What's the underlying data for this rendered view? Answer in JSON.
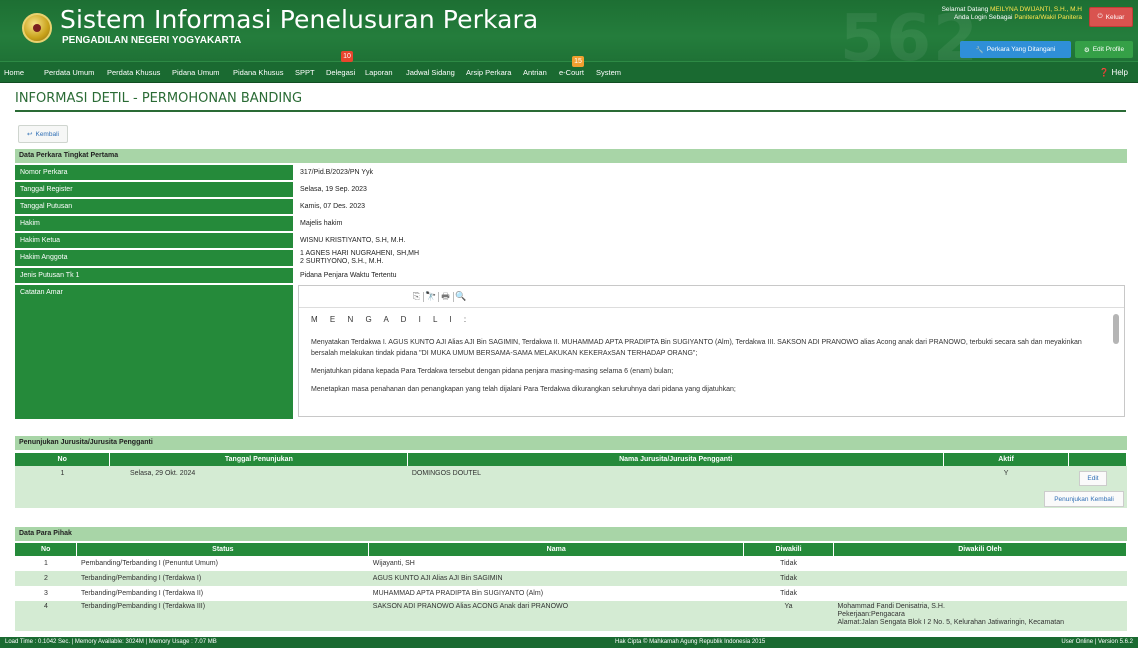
{
  "header": {
    "watermark": "562",
    "title": "Sistem Informasi Penelusuran Perkara",
    "subtitle": "PENGADILAN NEGERI YOGYAKARTA",
    "welcome_prefix": "Selamat Datang",
    "user_name": "MEILYNA DWIJANTI, S.H., M.H",
    "login_prefix": "Anda Login Sebagai",
    "role": "Panitera/Wakil Panitera",
    "logout_label": "Keluar",
    "perkara_ditangani_label": "Perkara Yang Ditangani",
    "edit_profile_label": "Edit Profile"
  },
  "nav": {
    "items": [
      "Home",
      "Perdata Umum",
      "Perdata Khusus",
      "Pidana Umum",
      "Pidana Khusus",
      "SPPT",
      "Delegasi",
      "Laporan",
      "Jadwal Sidang",
      "Arsip Perkara",
      "Antrian",
      "e-Court",
      "System"
    ],
    "delegasi_badge": "10",
    "ecourt_badge": "15",
    "help_label": "Help"
  },
  "page": {
    "title": "INFORMASI DETIL - PERMOHONAN BANDING",
    "back_label": "Kembali"
  },
  "perkara": {
    "section_title": "Data Perkara Tingkat Pertama",
    "rows": [
      {
        "label": "Nomor Perkara",
        "value": "317/Pid.B/2023/PN Yyk"
      },
      {
        "label": "Tanggal Register",
        "value": "Selasa, 19 Sep. 2023"
      },
      {
        "label": "Tanggal Putusan",
        "value": "Kamis, 07 Des. 2023"
      },
      {
        "label": "Hakim",
        "value": "Majelis hakim"
      },
      {
        "label": "Hakim Ketua",
        "value": "WISNU KRISTIYANTO, S.H, M.H."
      },
      {
        "label": "Hakim Anggota",
        "value": "1 AGNES HARI NUGRAHENI, SH,MH",
        "value2": "2 SURTIYONO, S.H., M.H."
      },
      {
        "label": "Jenis Putusan Tk 1",
        "value": "Pidana Penjara Waktu Tertentu"
      },
      {
        "label": "Catatan Amar"
      }
    ],
    "amar": {
      "heading": "M E N G A D I L I :",
      "p1": "Menyatakan Terdakwa I. AGUS KUNTO AJI Alias AJI Bin SAGIMIN, Terdakwa II. MUHAMMAD APTA PRADIPTA Bin SUGIYANTO (Alm), Terdakwa III. SAKSON ADI PRANOWO alias Acong anak dari PRANOWO, terbukti secara sah dan meyakinkan bersalah melakukan tindak pidana \"DI MUKA UMUM  BERSAMA-SAMA MELAKUKAN KEKERAxSAN TERHADAP ORANG\";",
      "p2": "Menjatuhkan pidana kepada Para Terdakwa tersebut dengan pidana penjara masing-masing selama 6 (enam) bulan;",
      "p3": "Menetapkan masa penahanan dan penangkapan yang telah dijalani Para Terdakwa dikurangkan seluruhnya dari pidana yang dijatuhkan;"
    }
  },
  "jurusita": {
    "section_title": "Penunjukan Jurusita/Jurusita Pengganti",
    "columns": [
      "No",
      "Tanggal Penunjukan",
      "Nama Jurusita/Jurusita Pengganti",
      "Aktif"
    ],
    "rows": [
      {
        "no": "1",
        "tanggal": "Selasa, 29 Okt. 2024",
        "nama": "DOMINGOS DOUTEL",
        "aktif": "Y"
      }
    ],
    "edit_label": "Edit",
    "penunjukan_kembali_label": "Penunjukan Kembali"
  },
  "pihak": {
    "section_title": "Data Para Pihak",
    "columns": [
      "No",
      "Status",
      "Nama",
      "Diwakili",
      "Diwakili Oleh"
    ],
    "rows": [
      {
        "no": "1",
        "status": "Pembanding/Terbanding I (Penuntut Umum)",
        "nama": "Wijayanti, SH",
        "diwakili": "Tidak",
        "oleh": ""
      },
      {
        "no": "2",
        "status": "Terbanding/Pembanding I (Terdakwa I)",
        "nama": "AGUS KUNTO AJI Alias AJI Bin SAGIMIN",
        "diwakili": "Tidak",
        "oleh": ""
      },
      {
        "no": "3",
        "status": "Terbanding/Pembanding I (Terdakwa II)",
        "nama": "MUHAMMAD APTA PRADIPTA Bin SUGIYANTO (Alm)",
        "diwakili": "Tidak",
        "oleh": ""
      },
      {
        "no": "4",
        "status": "Terbanding/Pembanding I (Terdakwa III)",
        "nama": "SAKSON ADI PRANOWO Alias ACONG Anak dari PRANOWO",
        "diwakili": "Ya",
        "oleh": "Mohammad Fandi Denisatria, S.H.",
        "oleh2": "Pekerjaan:Pengacara",
        "oleh3": "Alamat:Jalan Sengata Blok I 2 No. 5, Kelurahan Jatiwaringin, Kecamatan"
      }
    ]
  },
  "footer": {
    "left": "Load Time : 0.1042 Sec. | Memory Available: 3024M | Memory Usage : 7.07 MB",
    "center": "Hak Cipta © Mahkamah Agung Republik Indonesia 2015",
    "right": "User Online | Version 5.6.2"
  }
}
